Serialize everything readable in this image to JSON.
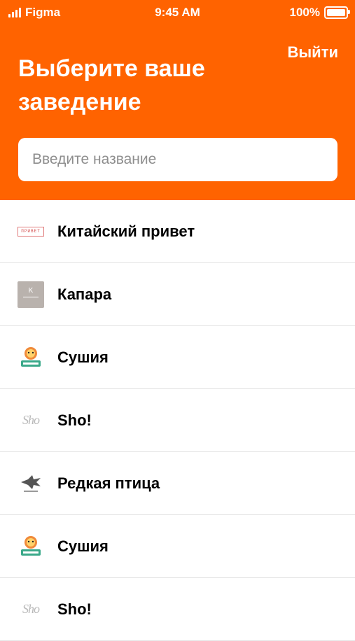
{
  "status_bar": {
    "carrier": "Figma",
    "time": "9:45 AM",
    "battery": "100%"
  },
  "header": {
    "logout_label": "Выйти",
    "title": "Выберите ваше заведение",
    "search_placeholder": "Введите название",
    "background_color": "#FF6300"
  },
  "venues": [
    {
      "name": "Китайский привет",
      "logo": "privet-logo",
      "logo_text": "ПРИВЕТ"
    },
    {
      "name": "Капара",
      "logo": "kapara-logo",
      "logo_text": "K"
    },
    {
      "name": "Сушия",
      "logo": "sushi-logo"
    },
    {
      "name": "Sho!",
      "logo": "sho-logo",
      "logo_text": "Sho"
    },
    {
      "name": "Редкая птица",
      "logo": "bird-logo"
    },
    {
      "name": "Сушия",
      "logo": "sushi-logo"
    },
    {
      "name": "Sho!",
      "logo": "sho-logo",
      "logo_text": "Sho"
    }
  ]
}
